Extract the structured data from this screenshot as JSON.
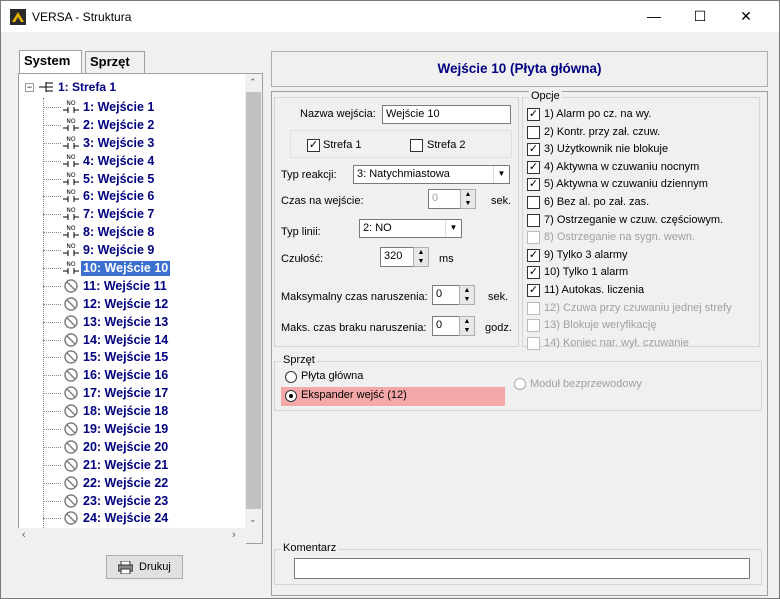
{
  "window": {
    "title": "VERSA - Struktura",
    "controls": {
      "minimize": "—",
      "maximize": "☐",
      "close": "✕"
    }
  },
  "left": {
    "tabs": [
      {
        "label": "System",
        "active": true
      },
      {
        "label": "Sprzęt",
        "active": false
      }
    ],
    "tree": {
      "root": "1: Strefa 1",
      "items": [
        {
          "label": "1: Wejście  1",
          "icon": "no-contact-icon"
        },
        {
          "label": "2: Wejście  2",
          "icon": "no-contact-icon"
        },
        {
          "label": "3: Wejście  3",
          "icon": "no-contact-icon"
        },
        {
          "label": "4: Wejście  4",
          "icon": "no-contact-icon"
        },
        {
          "label": "5: Wejście  5",
          "icon": "no-contact-icon"
        },
        {
          "label": "6: Wejście  6",
          "icon": "no-contact-icon"
        },
        {
          "label": "7: Wejście  7",
          "icon": "no-contact-icon"
        },
        {
          "label": "8: Wejście  8",
          "icon": "no-contact-icon"
        },
        {
          "label": "9: Wejście  9",
          "icon": "no-contact-icon"
        },
        {
          "label": "10: Wejście 10",
          "icon": "no-contact-icon",
          "selected": true
        },
        {
          "label": "11: Wejście 11",
          "icon": "disabled-icon"
        },
        {
          "label": "12: Wejście 12",
          "icon": "disabled-icon"
        },
        {
          "label": "13: Wejście 13",
          "icon": "disabled-icon"
        },
        {
          "label": "14: Wejście 14",
          "icon": "disabled-icon"
        },
        {
          "label": "15: Wejście 15",
          "icon": "disabled-icon"
        },
        {
          "label": "16: Wejście 16",
          "icon": "disabled-icon"
        },
        {
          "label": "17: Wejście 17",
          "icon": "disabled-icon"
        },
        {
          "label": "18: Wejście 18",
          "icon": "disabled-icon"
        },
        {
          "label": "19: Wejście 19",
          "icon": "disabled-icon"
        },
        {
          "label": "20: Wejście 20",
          "icon": "disabled-icon"
        },
        {
          "label": "21: Wejście 21",
          "icon": "disabled-icon"
        },
        {
          "label": "22: Wejście 22",
          "icon": "disabled-icon"
        },
        {
          "label": "23: Wejście 23",
          "icon": "disabled-icon"
        },
        {
          "label": "24: Wejście 24",
          "icon": "disabled-icon"
        }
      ],
      "icon_text": "NO"
    },
    "print_button": "Drukuj"
  },
  "header": {
    "title": "Wejście 10 (Płyta główna)"
  },
  "form": {
    "name_label": "Nazwa wejścia:",
    "name_value": "Wejście 10",
    "zone1_label": "Strefa 1",
    "zone1_checked": true,
    "zone2_label": "Strefa 2",
    "zone2_checked": false,
    "reaction_label": "Typ reakcji:",
    "reaction_value": "3: Natychmiastowa",
    "entry_time_label": "Czas na wejście:",
    "entry_time_value": "0",
    "entry_time_unit": "sek.",
    "line_type_label": "Typ linii:",
    "line_type_value": "2: NO",
    "sensitivity_label": "Czułość:",
    "sensitivity_value": "320",
    "sensitivity_unit": "ms",
    "max_violation_label": "Maksymalny czas naruszenia:",
    "max_violation_value": "0",
    "max_violation_unit": "sek.",
    "max_no_violation_label": "Maks. czas braku naruszenia:",
    "max_no_violation_value": "0",
    "max_no_violation_unit": "godz."
  },
  "options": {
    "title": "Opcje",
    "items": [
      {
        "label": "1) Alarm po cz. na wy.",
        "checked": true,
        "enabled": true
      },
      {
        "label": "2) Kontr. przy zał. czuw.",
        "checked": false,
        "enabled": true
      },
      {
        "label": "3) Użytkownik nie blokuje",
        "checked": true,
        "enabled": true
      },
      {
        "label": "4) Aktywna w czuwaniu nocnym",
        "checked": true,
        "enabled": true
      },
      {
        "label": "5) Aktywna w czuwaniu dziennym",
        "checked": true,
        "enabled": true
      },
      {
        "label": "6) Bez al. po zał. zas.",
        "checked": false,
        "enabled": true
      },
      {
        "label": "7) Ostrzeganie w czuw. częściowym.",
        "checked": false,
        "enabled": true
      },
      {
        "label": "8) Ostrzeganie na sygn. wewn.",
        "checked": false,
        "enabled": false
      },
      {
        "label": "9) Tylko 3 alarmy",
        "checked": true,
        "enabled": true
      },
      {
        "label": "10) Tylko 1 alarm",
        "checked": true,
        "enabled": true
      },
      {
        "label": "11) Autokas. liczenia",
        "checked": true,
        "enabled": true
      },
      {
        "label": "12) Czuwa przy czuwaniu jednej strefy",
        "checked": false,
        "enabled": false
      },
      {
        "label": "13) Blokuje weryfikację",
        "checked": false,
        "enabled": false
      },
      {
        "label": "14) Koniec nar. wył. czuwanie",
        "checked": false,
        "enabled": false
      }
    ]
  },
  "hardware": {
    "title": "Sprzęt",
    "main_board": "Płyta główna",
    "expander": "Ekspander wejść (12)",
    "wireless": "Moduł bezprzewodowy",
    "selected": "expander"
  },
  "comment": {
    "title": "Komentarz",
    "value": ""
  }
}
